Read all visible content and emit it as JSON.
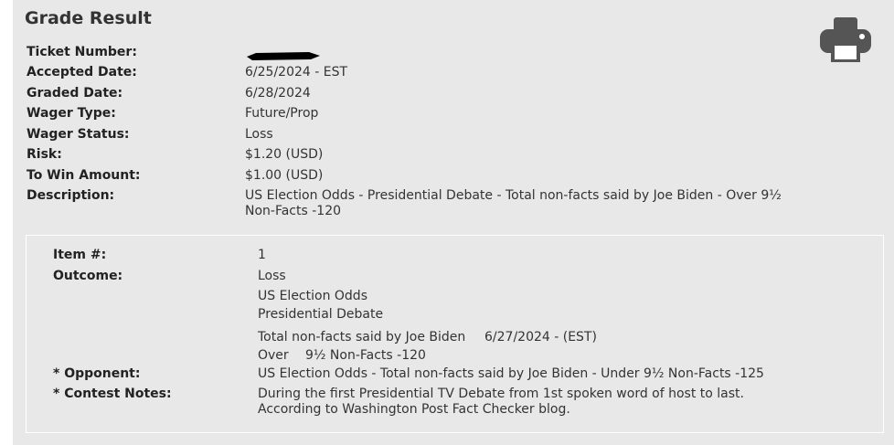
{
  "title": "Grade Result",
  "ticket": {
    "ticket_number_label": "Ticket Number:",
    "accepted_date_label": "Accepted Date:",
    "accepted_date": "6/25/2024 - EST",
    "graded_date_label": "Graded Date:",
    "graded_date": "6/28/2024",
    "wager_type_label": "Wager Type:",
    "wager_type": "Future/Prop",
    "wager_status_label": "Wager Status:",
    "wager_status": "Loss",
    "risk_label": "Risk:",
    "risk": "$1.20 (USD)",
    "to_win_label": "To Win Amount:",
    "to_win": "$1.00 (USD)",
    "description_label": "Description:",
    "description_line1": "US Election Odds - Presidential Debate - Total non-facts said by Joe Biden - Over 9½",
    "description_line2": "Non-Facts -120"
  },
  "item": {
    "item_number_label": "Item #:",
    "item_number": "1",
    "outcome_label": "Outcome:",
    "outcome": "Loss",
    "league": "US Election Odds",
    "event": "Presidential Debate",
    "game": "Total non-facts said by Joe Biden",
    "game_date": "6/27/2024 - (EST)",
    "selection": "Over",
    "line": "9½ Non-Facts  -120",
    "opponent_label": "* Opponent:",
    "opponent": "US Election Odds - Total non-facts said by Joe Biden - Under 9½ Non-Facts -125",
    "contest_notes_label": "* Contest Notes:",
    "contest_notes_line1": "During the first Presidential TV Debate from 1st spoken word of host to last.",
    "contest_notes_line2": "According to Washington Post Fact Checker blog."
  },
  "icons": {
    "print": "printer-icon"
  },
  "colors": {
    "panel_bg": "#e8e8e8",
    "icon": "#555555",
    "redaction": "#000000"
  }
}
